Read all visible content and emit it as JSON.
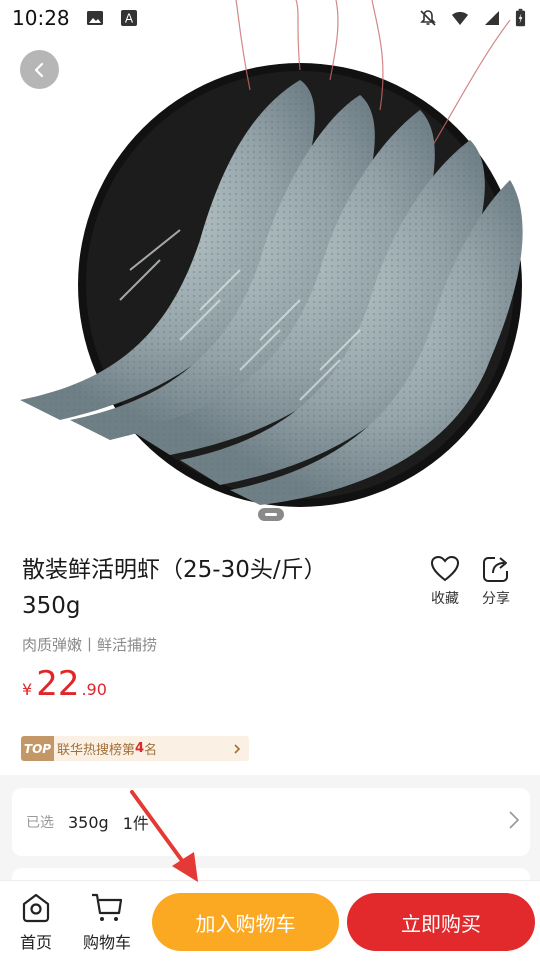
{
  "status_bar": {
    "time": "10:28",
    "icons": [
      "image-icon",
      "font-a-icon",
      "mute-bell-icon",
      "wifi-icon",
      "signal-icon",
      "battery-charging-icon"
    ]
  },
  "hero": {
    "image_subject": "shrimp-on-black-plate",
    "page_indicator": "1"
  },
  "product": {
    "title": "散装鲜活明虾（25-30头/斤） 350g",
    "subtitle": "肉质弹嫩丨鲜活捕捞",
    "price_symbol": "¥",
    "price_integer": "22",
    "price_decimal": ".90",
    "favorite_label": "收藏",
    "share_label": "分享"
  },
  "rank": {
    "tag": "TOP",
    "text_prefix": "联华热搜榜第",
    "rank_number": "4",
    "text_suffix": "名"
  },
  "selection": {
    "label": "已选",
    "weight": "350g",
    "quantity": "1件"
  },
  "bottom_nav": {
    "home_label": "首页",
    "cart_label": "购物车",
    "add_to_cart": "加入购物车",
    "buy_now": "立即购买"
  },
  "colors": {
    "accent_red": "#e2292c",
    "accent_orange": "#fba823",
    "rank_bg": "#fbf0e4",
    "annotation_arrow": "#e53935"
  }
}
